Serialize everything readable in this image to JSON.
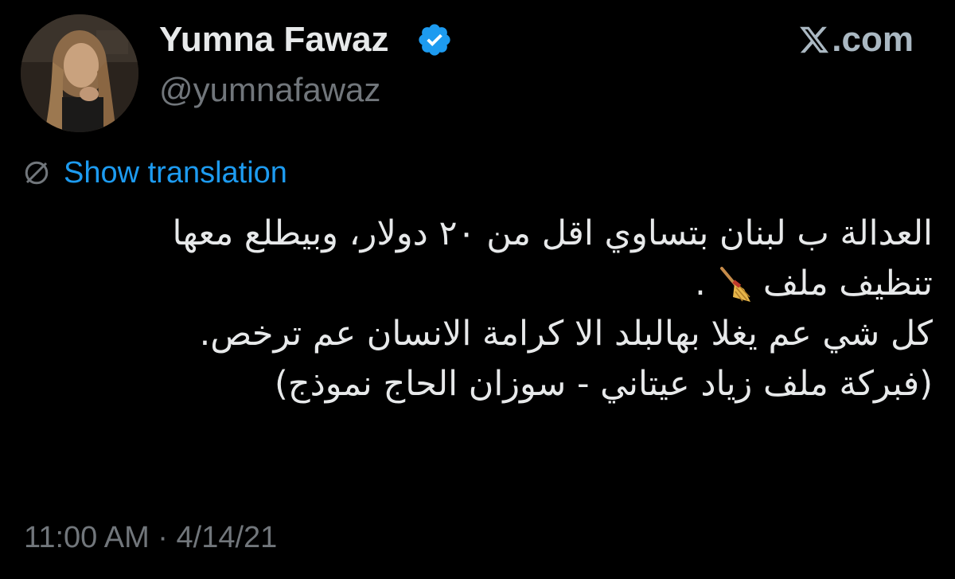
{
  "author": {
    "display_name": "Yumna Fawaz",
    "handle": "@yumnafawaz",
    "verified": true,
    "avatar_icon": "profile-photo"
  },
  "brand": {
    "logo_icon": "x-logo-icon",
    "domain_suffix": ".com"
  },
  "translation": {
    "icon": "translate-globe-icon",
    "label": "Show translation"
  },
  "tweet": {
    "lines": [
      "العدالة ب لبنان بتساوي اقل من ٢٠ دولار، وبيطلع معها",
      "تنظيف ملف",
      "كل شي عم يغلا بهالبلد الا كرامة الانسان عم ترخص.",
      "(فبركة ملف زياد عيتاني - سوزان الحاج نموذج)"
    ],
    "inline_emoji": "broom-icon",
    "line2_punctuation": "."
  },
  "meta": {
    "timestamp": "11:00 AM · 4/14/21"
  },
  "colors": {
    "background": "#000000",
    "text_primary": "#e7e9ea",
    "text_secondary": "#71767b",
    "link": "#1d9bf0",
    "verified_badge": "#1d9bf0"
  }
}
